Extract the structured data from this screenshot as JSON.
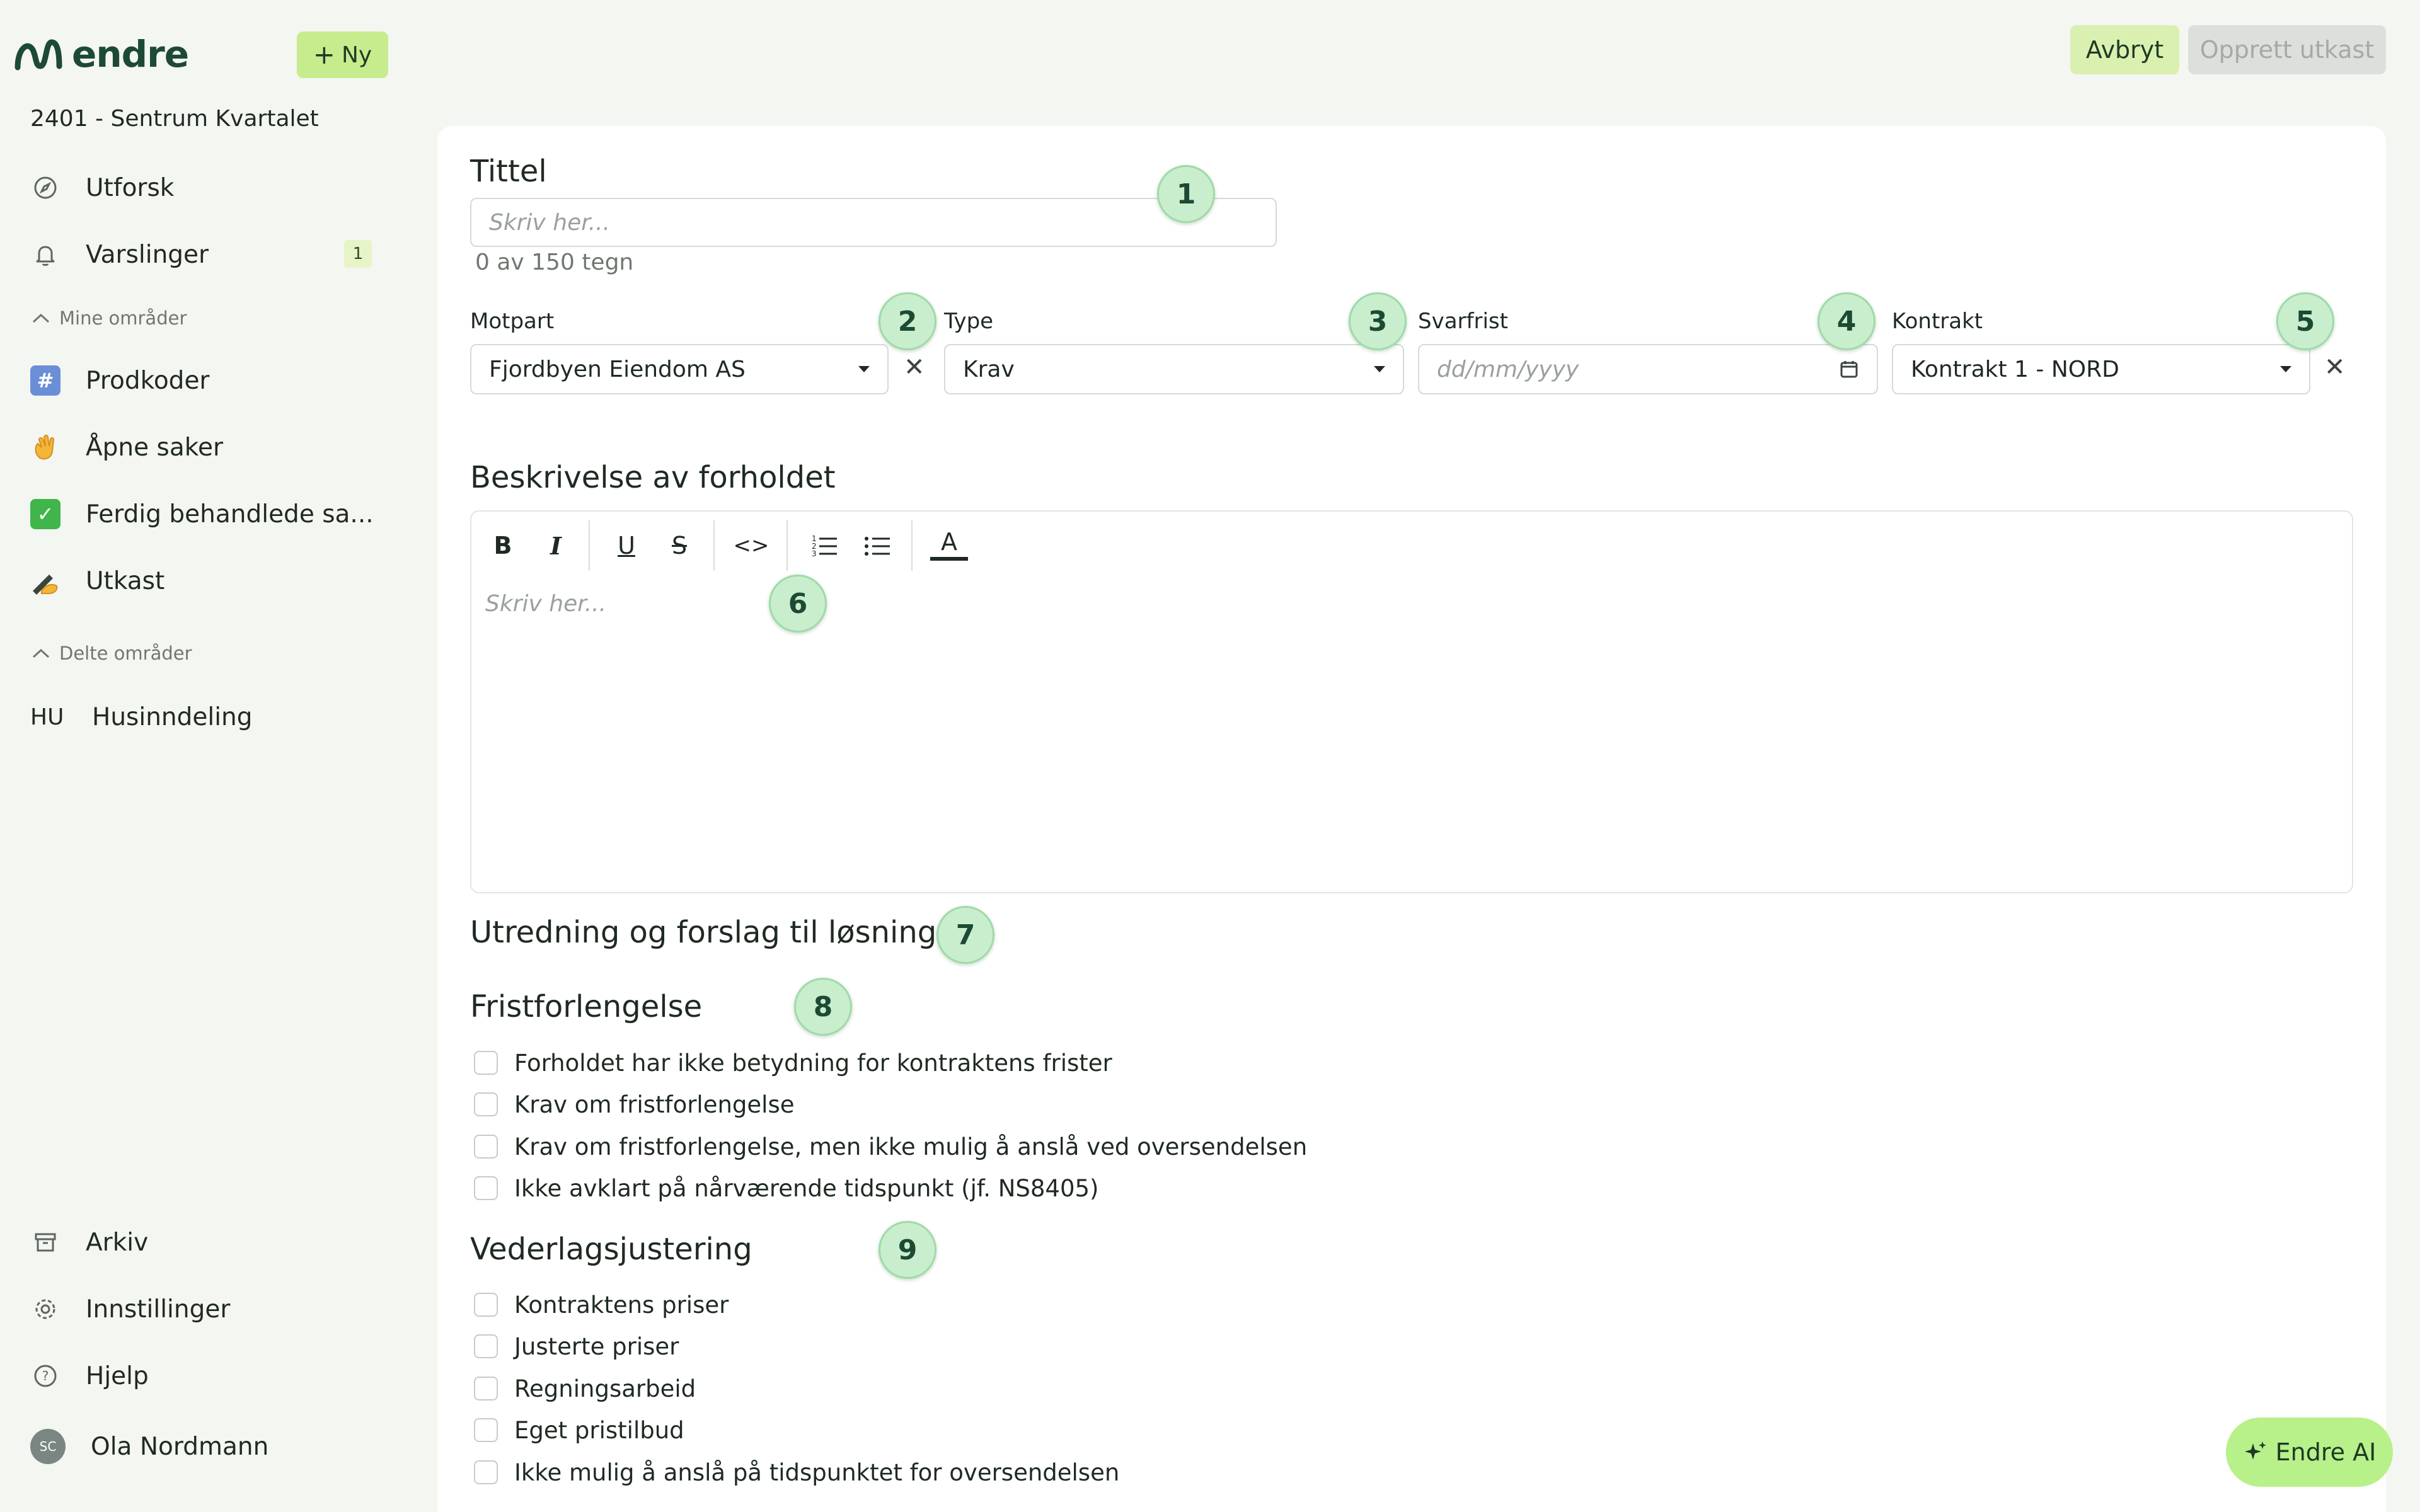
{
  "app": {
    "logo_text": "endre",
    "new_button": "Ny"
  },
  "sidebar": {
    "project": "2401 - Sentrum Kvartalet",
    "explore": "Utforsk",
    "notifications": {
      "label": "Varslinger",
      "count": "1"
    },
    "my_areas_header": "Mine områder",
    "my_areas": [
      {
        "label": "Prodkoder",
        "icon": "hash-icon"
      },
      {
        "label": "Åpne saker",
        "icon": "waving-hand-icon"
      },
      {
        "label": "Ferdig behandlede sa...",
        "icon": "check-box-icon"
      },
      {
        "label": "Utkast",
        "icon": "writing-hand-icon"
      }
    ],
    "shared_areas_header": "Delte områder",
    "shared_areas": [
      {
        "code": "HU",
        "label": "Husinndeling"
      }
    ],
    "archive": "Arkiv",
    "settings": "Innstillinger",
    "help": "Hjelp",
    "user": {
      "initials": "SC",
      "name": "Ola Nordmann"
    }
  },
  "header": {
    "cancel": "Avbryt",
    "create_draft": "Opprett utkast"
  },
  "form": {
    "title_label": "Tittel",
    "title_placeholder": "Skriv her...",
    "title_counter": "0 av 150 tegn",
    "counterparty_label": "Motpart",
    "counterparty_value": "Fjordbyen Eiendom AS",
    "type_label": "Type",
    "type_value": "Krav",
    "deadline_label": "Svarfrist",
    "deadline_placeholder": "dd/mm/yyyy",
    "contract_label": "Kontrakt",
    "contract_value": "Kontrakt 1 - NORD",
    "description_title": "Beskrivelse av forholdet",
    "description_placeholder": "Skriv her...",
    "toolbar": {
      "bold": "B",
      "italic": "I",
      "underline": "U",
      "strike": "S",
      "code": "<>",
      "text_color": "A"
    },
    "investigation_title": "Utredning og forslag til løsning",
    "extension_title": "Fristforlengelse",
    "extension_options": [
      "Forholdet har ikke betydning for kontraktens frister",
      "Krav om fristforlengelse",
      "Krav om fristforlengelse, men ikke mulig å anslå ved oversendelsen",
      "Ikke avklart på nårværende tidspunkt (jf. NS8405)"
    ],
    "compensation_title": "Vederlagsjustering",
    "compensation_options": [
      "Kontraktens priser",
      "Justerte priser",
      "Regningsarbeid",
      "Eget pristilbud",
      "Ikke mulig å anslå på tidspunktet for oversendelsen"
    ]
  },
  "markers": [
    "1",
    "2",
    "3",
    "4",
    "5",
    "6",
    "7",
    "8",
    "9"
  ],
  "ai_button": "Endre AI",
  "colors": {
    "brand": "#1d4a34",
    "accent": "#c7ec8d",
    "marker_bg": "#c9eecd"
  }
}
